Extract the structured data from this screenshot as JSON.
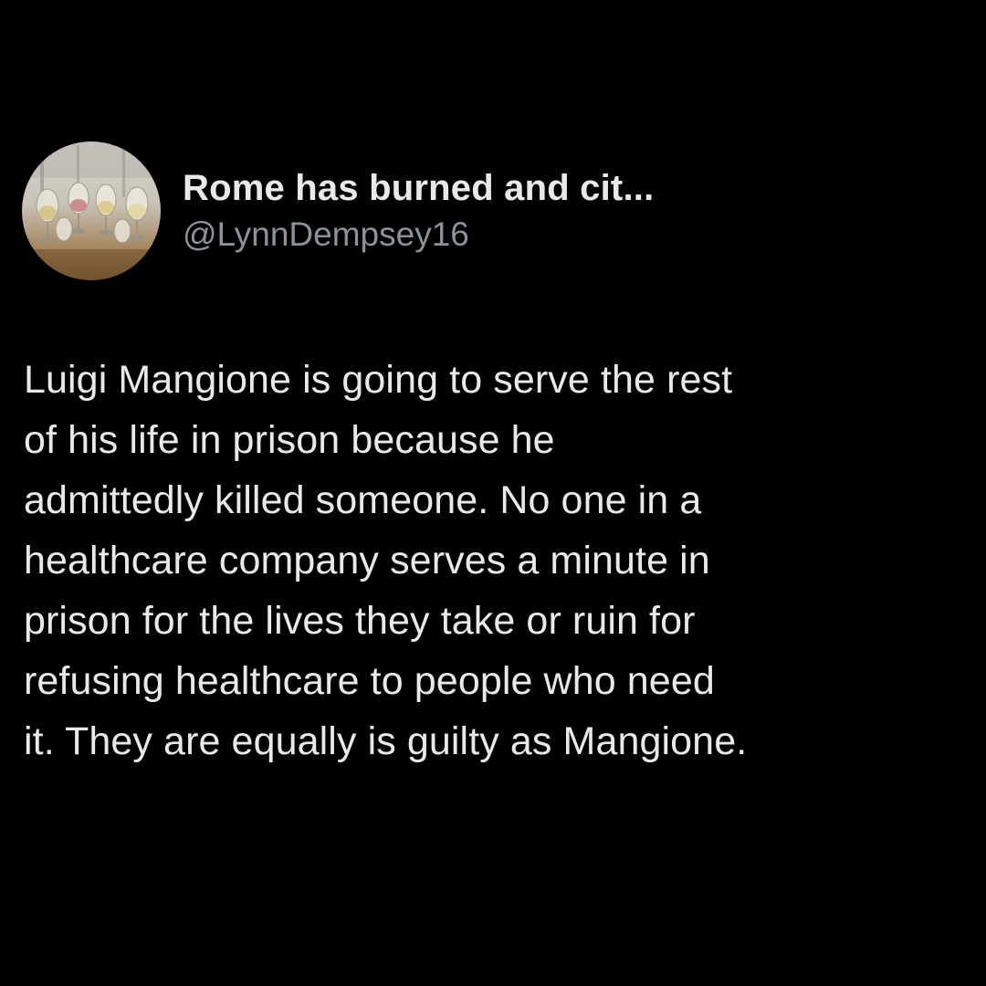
{
  "tweet": {
    "author": {
      "display_name": "Rome has burned and cit...",
      "handle": "@LynnDempsey16",
      "avatar_icon": "profile-photo-wine-glasses"
    },
    "text_lines": [
      "Luigi Mangione is going to serve the rest",
      "of his life in prison because he",
      "admittedly killed someone. No one in a",
      "healthcare company serves a minute in",
      "prison for the lives they take or ruin for",
      "refusing healthcare to people who need",
      "it. They are equally is guilty as Mangione."
    ]
  },
  "colors": {
    "background": "#000000",
    "primary_text": "#e7e9ea",
    "secondary_text": "#8b9299"
  }
}
